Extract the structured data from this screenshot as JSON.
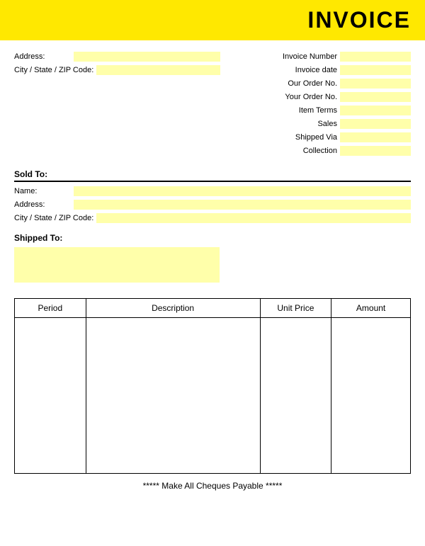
{
  "header": {
    "title": "INVOICE"
  },
  "left_top": {
    "address_label": "Address:",
    "city_label": "City / State / ZIP Code:"
  },
  "right_top": {
    "invoice_number_label": "Invoice Number",
    "invoice_date_label": "Invoice date",
    "our_order_label": "Our Order No.",
    "your_order_label": "Your Order No.",
    "item_terms_label": "Item Terms",
    "sales_label": "Sales",
    "shipped_via_label": "Shipped Via",
    "collection_label": "Collection"
  },
  "sold_to": {
    "label": "Sold To:",
    "name_label": "Name:",
    "address_label": "Address:",
    "city_label": "City / State / ZIP Code:"
  },
  "shipped_to": {
    "label": "Shipped To:"
  },
  "table": {
    "col_period": "Period",
    "col_description": "Description",
    "col_unit_price": "Unit Price",
    "col_amount": "Amount"
  },
  "footer": {
    "text": "***** Make All Cheques Payable *****"
  }
}
